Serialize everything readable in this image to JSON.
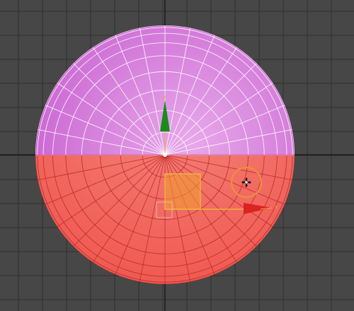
{
  "viewport": {
    "view_label": "",
    "background_color": "#474747",
    "grid_color": "#2f2f2f",
    "grid_major_color": "#1c1c1c"
  },
  "sphere": {
    "top_color": "#c75fd0",
    "top_highlight_color": "#e7a8ea",
    "bottom_color": "#ef5a52",
    "bottom_highlight_color": "#f58a80",
    "wire_top_color": "#ffffff",
    "wire_bottom_color": "#c02828"
  },
  "gizmo": {
    "y_axis_label": "y",
    "x_axis_label": "x",
    "y_axis_color": "#1a8c1a",
    "x_axis_color": "#dd2222",
    "plane_color": "#f0a030",
    "handle_color": "#d4a070",
    "cursor_icon": "move-cursor-icon"
  }
}
